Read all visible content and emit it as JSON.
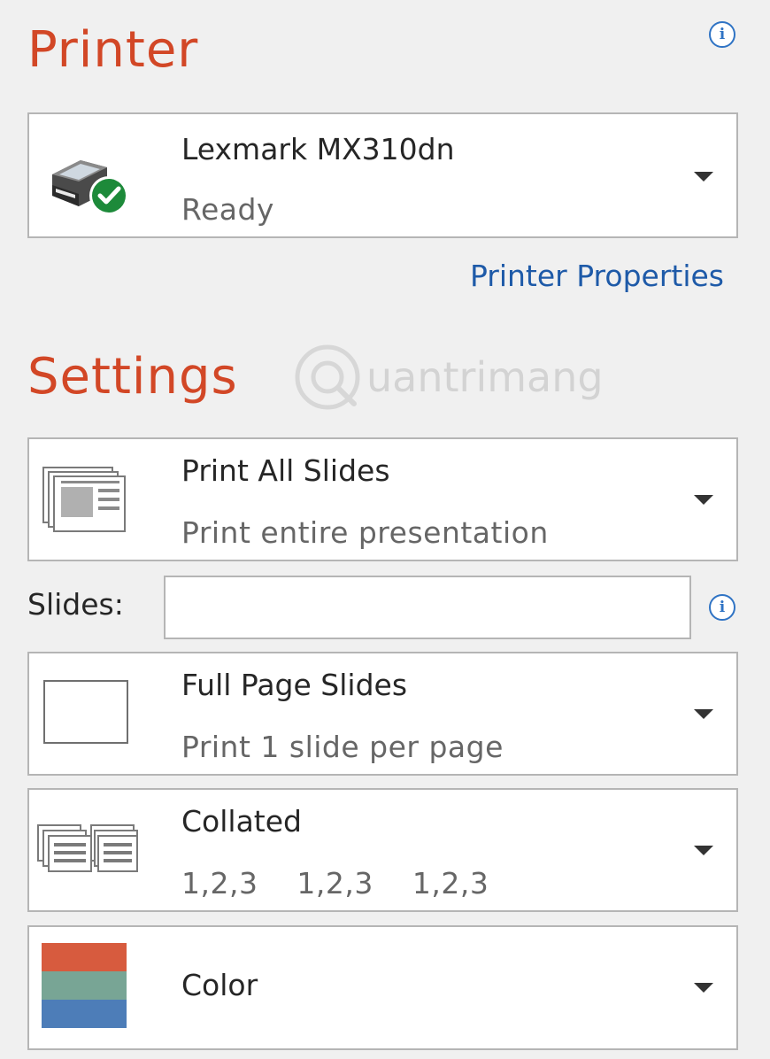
{
  "printer": {
    "heading": "Printer",
    "name": "Lexmark MX310dn",
    "status": "Ready",
    "properties_link": "Printer Properties",
    "icon": "printer-ready-icon"
  },
  "settings": {
    "heading": "Settings",
    "watermark": "uantrimang",
    "print_range": {
      "title": "Print All Slides",
      "subtitle": "Print entire presentation",
      "icon": "slides-stack-icon"
    },
    "slides_field": {
      "label": "Slides:",
      "value": ""
    },
    "layout": {
      "title": "Full Page Slides",
      "subtitle": "Print 1 slide per page",
      "icon": "full-page-slide-icon"
    },
    "collation": {
      "title": "Collated",
      "subtitle": "1,2,3    1,2,3    1,2,3",
      "icon": "collated-pages-icon"
    },
    "color_mode": {
      "title": "Color",
      "icon": "color-swatch-icon",
      "swatch_colors": [
        "#d75b3e",
        "#78a595",
        "#4d7db8"
      ]
    }
  },
  "colors": {
    "heading": "#d24726",
    "link": "#1e5aa8",
    "info": "#2f73c4",
    "ready_badge": "#1d8a3a"
  }
}
